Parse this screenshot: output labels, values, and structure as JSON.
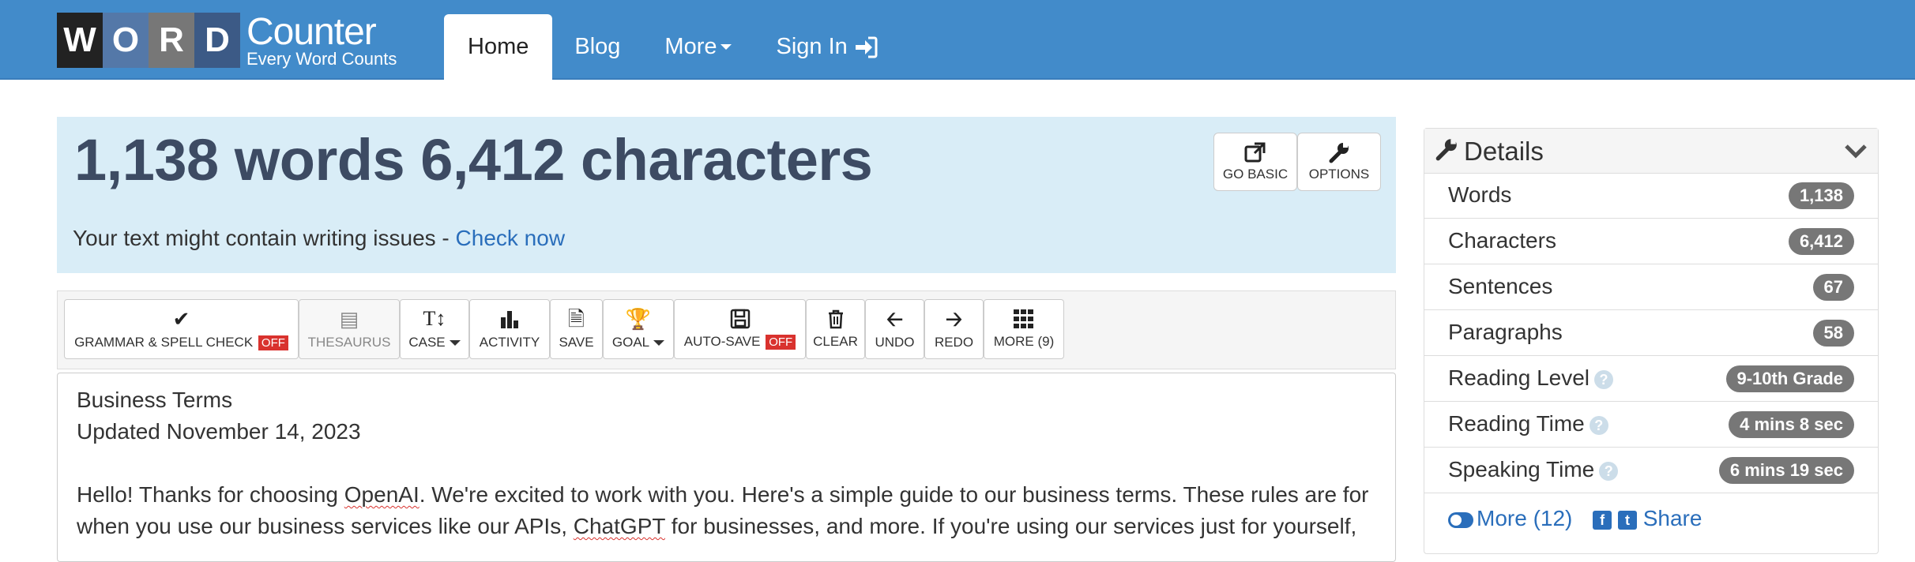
{
  "nav": {
    "logo_letters": [
      "W",
      "O",
      "R",
      "D"
    ],
    "logo_title": "Counter",
    "logo_tagline": "Every Word Counts",
    "items": [
      {
        "label": "Home",
        "active": true
      },
      {
        "label": "Blog"
      },
      {
        "label": "More"
      },
      {
        "label": "Sign In",
        "icon": "sign-in-icon"
      }
    ]
  },
  "stats": {
    "headline": "1,138 words 6,412 characters",
    "issue_text": "Your text might contain writing issues - ",
    "issue_link": "Check now",
    "go_basic": "GO BASIC",
    "options": "OPTIONS"
  },
  "toolbar": {
    "grammar": "GRAMMAR & SPELL CHECK",
    "off": "OFF",
    "thesaurus": "THESAURUS",
    "case": "CASE",
    "activity": "ACTIVITY",
    "save": "SAVE",
    "goal": "GOAL",
    "autosave": "AUTO-SAVE",
    "clear": "CLEAR",
    "undo": "UNDO",
    "redo": "REDO",
    "more": "MORE (9)"
  },
  "editor": {
    "line1": "Business Terms",
    "line2": "Updated November 14, 2023",
    "p1a": "Hello! Thanks for choosing ",
    "p1b": "OpenAI",
    "p1c": ". We're excited to work with you. Here's a simple guide to our business terms. These rules are for",
    "p2a": "when you use our business services like our APIs, ",
    "p2b": "ChatGPT",
    "p2c": " for businesses, and more. If you're using our services just for yourself,"
  },
  "details": {
    "title": "Details",
    "rows": [
      {
        "label": "Words",
        "value": "1,138"
      },
      {
        "label": "Characters",
        "value": "6,412"
      },
      {
        "label": "Sentences",
        "value": "67"
      },
      {
        "label": "Paragraphs",
        "value": "58"
      },
      {
        "label": "Reading Level",
        "value": "9-10th Grade",
        "help": true
      },
      {
        "label": "Reading Time",
        "value": "4 mins 8 sec",
        "help": true
      },
      {
        "label": "Speaking Time",
        "value": "6 mins 19 sec",
        "help": true
      }
    ],
    "more": "More (12)",
    "share": "Share"
  },
  "colors": {
    "navbar": "#428bca",
    "banner": "#d9edf7",
    "headline": "#3d4b63",
    "link": "#2a6ebb",
    "off_badge": "#d9322e",
    "count_badge": "#777777"
  }
}
